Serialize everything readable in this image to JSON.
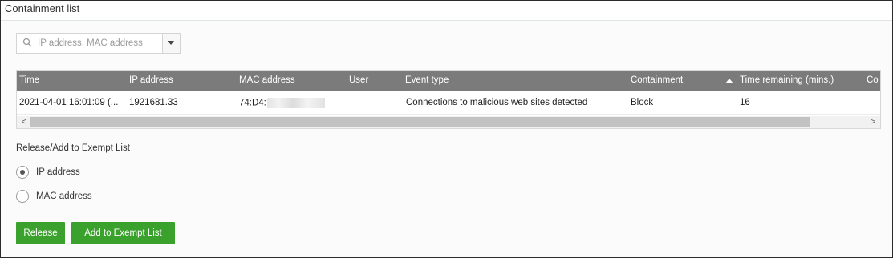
{
  "panel": {
    "title": "Containment list"
  },
  "search": {
    "placeholder": "IP address, MAC address"
  },
  "table": {
    "columns": [
      "Time",
      "IP address",
      "MAC address",
      "User",
      "Event type",
      "Containment",
      "Time remaining (mins.)",
      "Co"
    ],
    "sorted_column": "Time remaining (mins.)",
    "sort_direction": "ascending",
    "rows": [
      {
        "time": "2021-04-01 16:01:09 (...",
        "ip": "1921681.33",
        "mac": "74:D4:",
        "user": "",
        "event": "Connections to malicious web sites detected",
        "containment": "Block",
        "remaining": "16"
      }
    ],
    "scroll_left": "<",
    "scroll_right": ">"
  },
  "release_options": {
    "label": "Release/Add to Exempt List",
    "options": [
      {
        "label": "IP address",
        "selected": true
      },
      {
        "label": "MAC address",
        "selected": false
      }
    ]
  },
  "actions": {
    "release_label": "Release",
    "exempt_label": "Add to Exempt List"
  },
  "colors": {
    "header_bg": "#7b7b7b",
    "button_bg": "#3aa12c"
  },
  "icons": [
    "search-icon",
    "chevron-down-icon",
    "sort-ascending-icon"
  ]
}
